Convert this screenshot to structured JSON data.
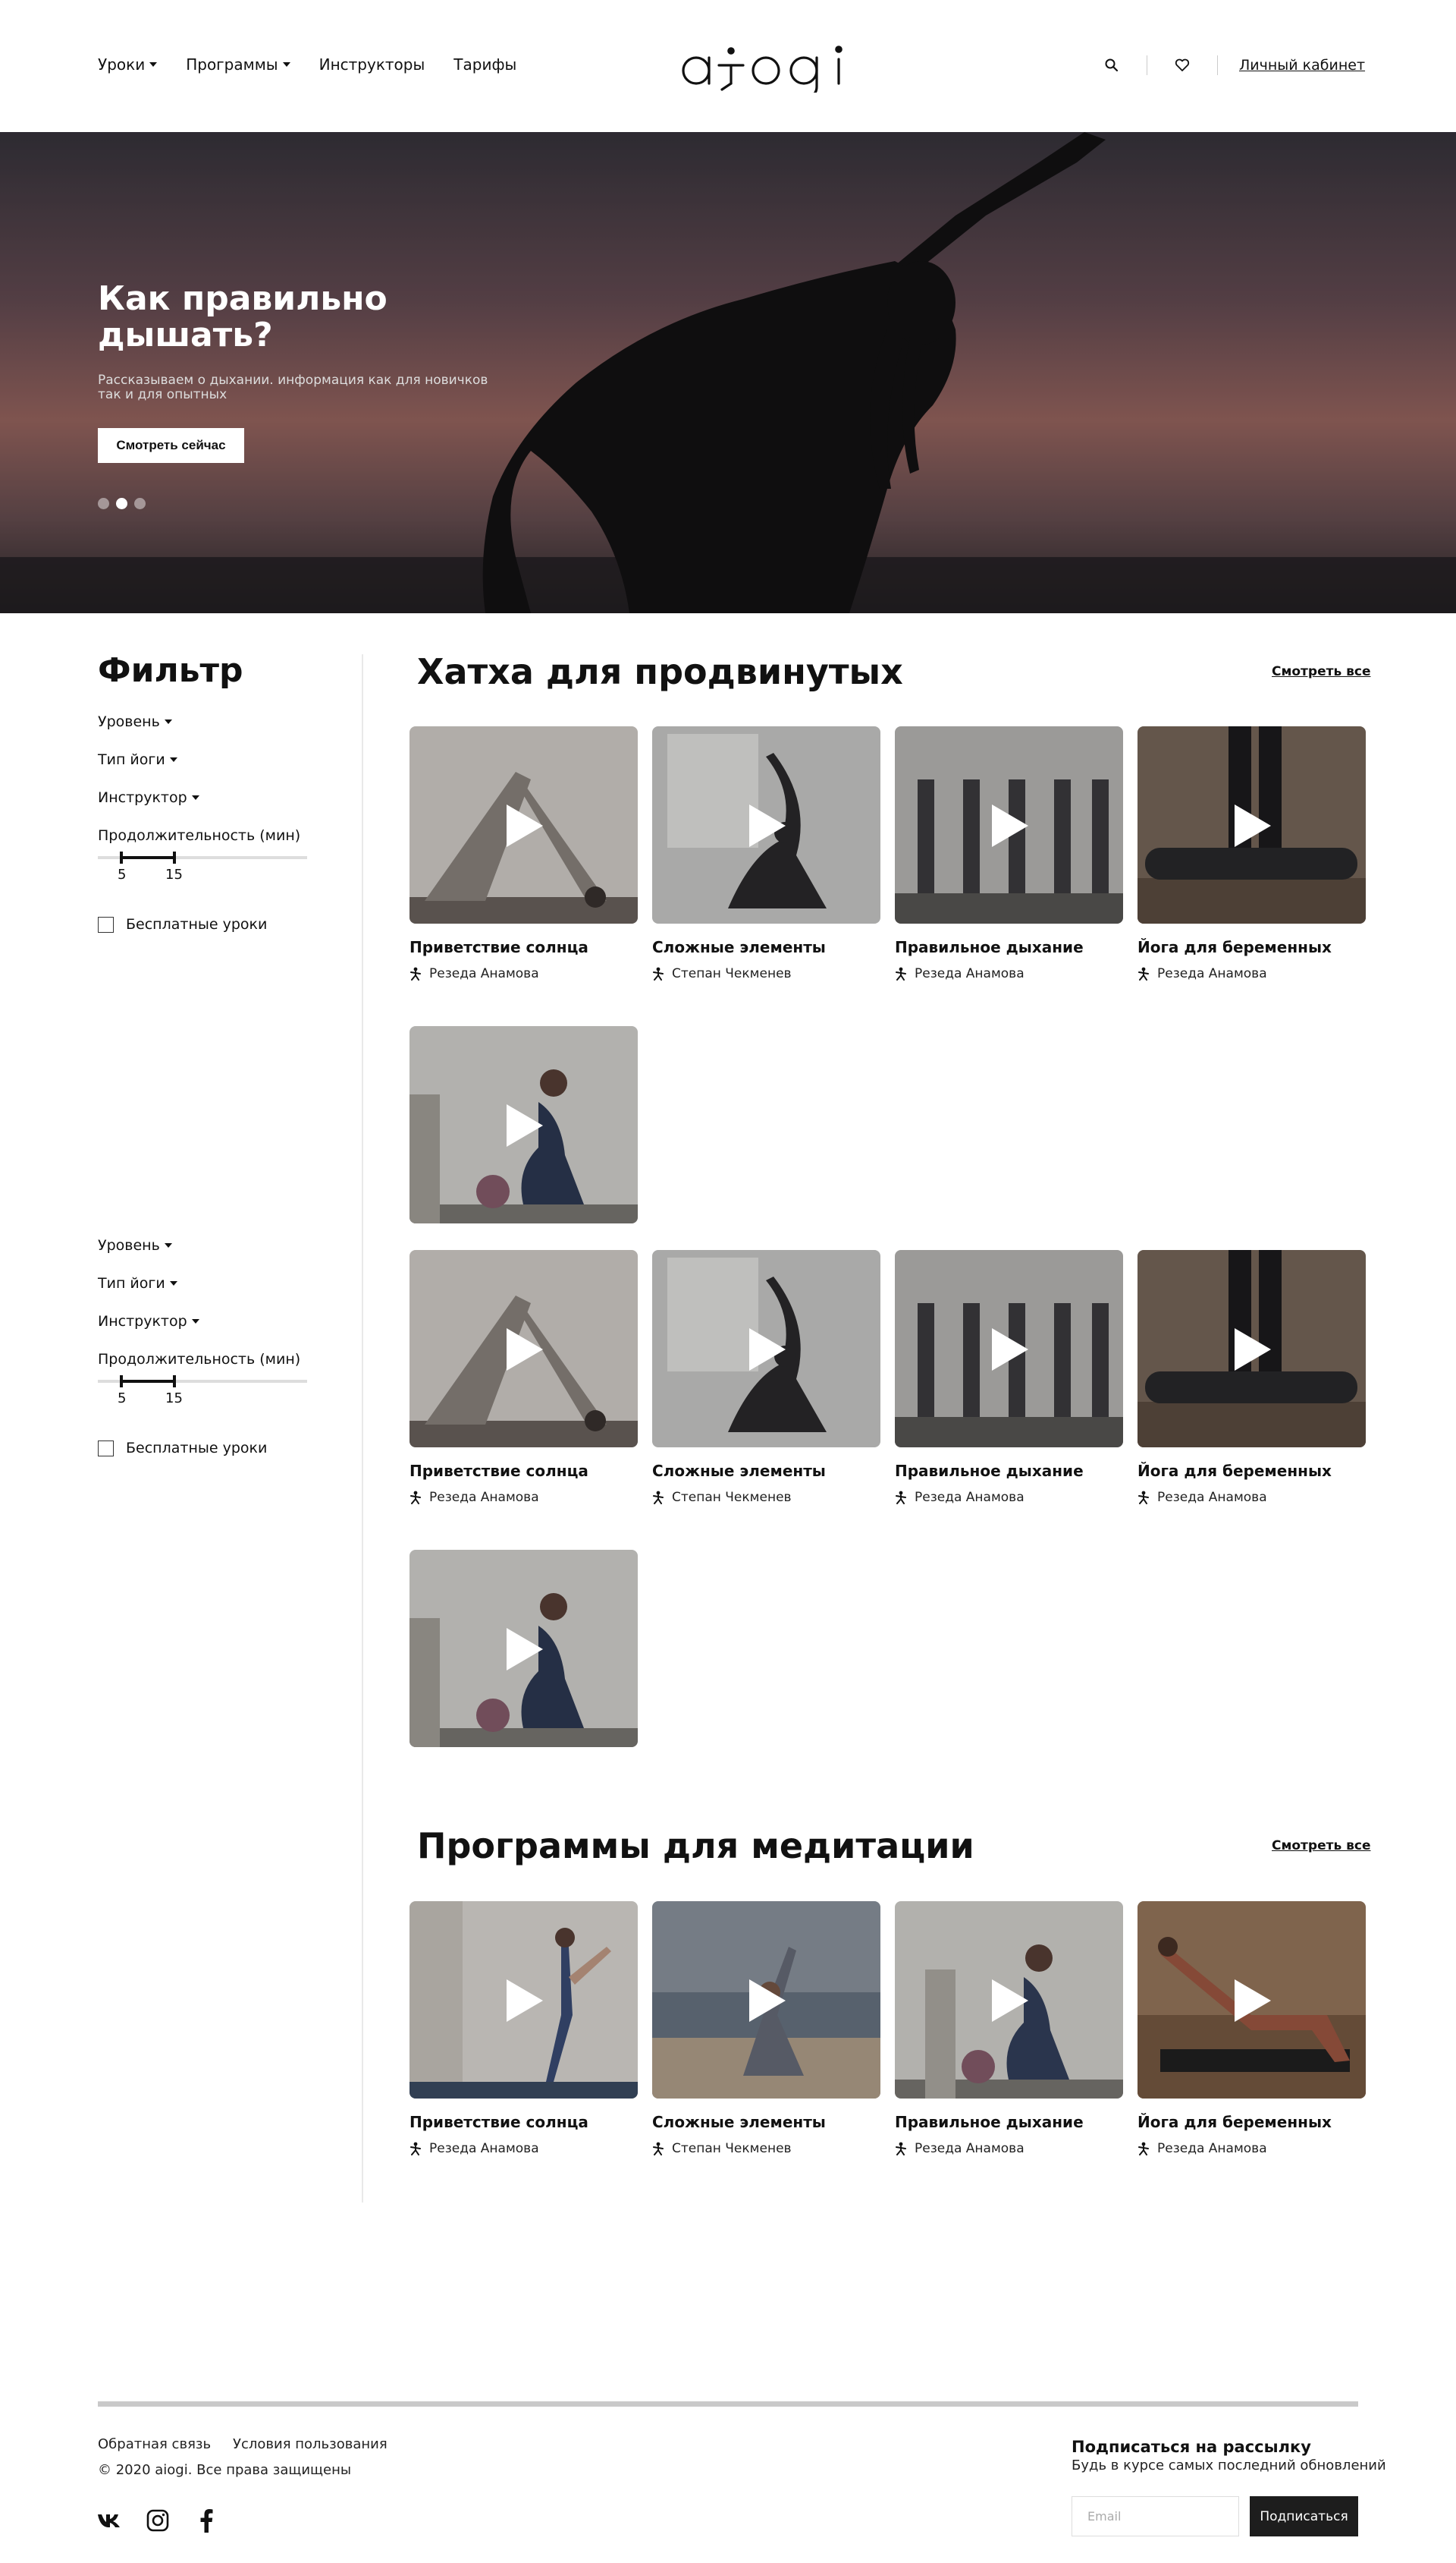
{
  "header": {
    "nav": [
      {
        "label": "Уроки",
        "dropdown": true
      },
      {
        "label": "Программы",
        "dropdown": true
      },
      {
        "label": "Инструкторы",
        "dropdown": false
      },
      {
        "label": "Тарифы",
        "dropdown": false
      }
    ],
    "logo": "aiogi",
    "account_label": "Личный кабинет",
    "icons": [
      "search-icon",
      "heart-icon"
    ]
  },
  "hero": {
    "title": "Как правильно дышать?",
    "subtitle": "Рассказываем о дыхании. информация как для новичков так и для опытных",
    "button_label": "Смотреть сейчас",
    "slides": 3,
    "active_slide": 2
  },
  "filter": {
    "title": "Фильтр",
    "level_label": "Уровень",
    "type_label": "Тип йоги",
    "instructor_label": "Инструктор",
    "duration_label": "Продолжительность (мин)",
    "duration_min": "5",
    "duration_max": "15",
    "free_label": "Бесплатные уроки"
  },
  "sections": {
    "hatha": {
      "title": "Хатха для продвинутых",
      "see_all": "Смотреть все",
      "cards": [
        {
          "title": "Приветствие солнца",
          "author": "Резеда Анамова"
        },
        {
          "title": "Сложные элементы",
          "author": "Степан Чекменев"
        },
        {
          "title": "Правильное дыхание",
          "author": "Резеда Анамова"
        },
        {
          "title": "Йога для беременных",
          "author": "Резеда Анамова"
        }
      ],
      "cards_repeat": [
        {
          "title": "Приветствие солнца",
          "author": "Резеда Анамова"
        },
        {
          "title": "Сложные элементы",
          "author": "Степан Чекменев"
        },
        {
          "title": "Правильное дыхание",
          "author": "Резеда Анамова"
        },
        {
          "title": "Йога для беременных",
          "author": "Резеда Анамова"
        }
      ]
    },
    "meditation": {
      "title": "Программы для медитации",
      "see_all": "Смотреть все",
      "cards": [
        {
          "title": "Приветствие солнца",
          "author": "Резеда Анамова"
        },
        {
          "title": "Сложные элементы",
          "author": "Степан Чекменев"
        },
        {
          "title": "Правильное дыхание",
          "author": "Резеда Анамова"
        },
        {
          "title": "Йога для беременных",
          "author": "Резеда Анамова"
        }
      ]
    }
  },
  "footer": {
    "links": [
      "Обратная связь",
      "Условия пользования"
    ],
    "copyright": "© 2020 aiogi. Все права защищены",
    "socials": [
      "vk-icon",
      "instagram-icon",
      "facebook-icon"
    ],
    "subscribe_title": "Подписаться на рассылку",
    "subscribe_desc": "Будь в курсе самых последний обновлений",
    "email_placeholder": "Email",
    "subscribe_button": "Подписаться"
  }
}
